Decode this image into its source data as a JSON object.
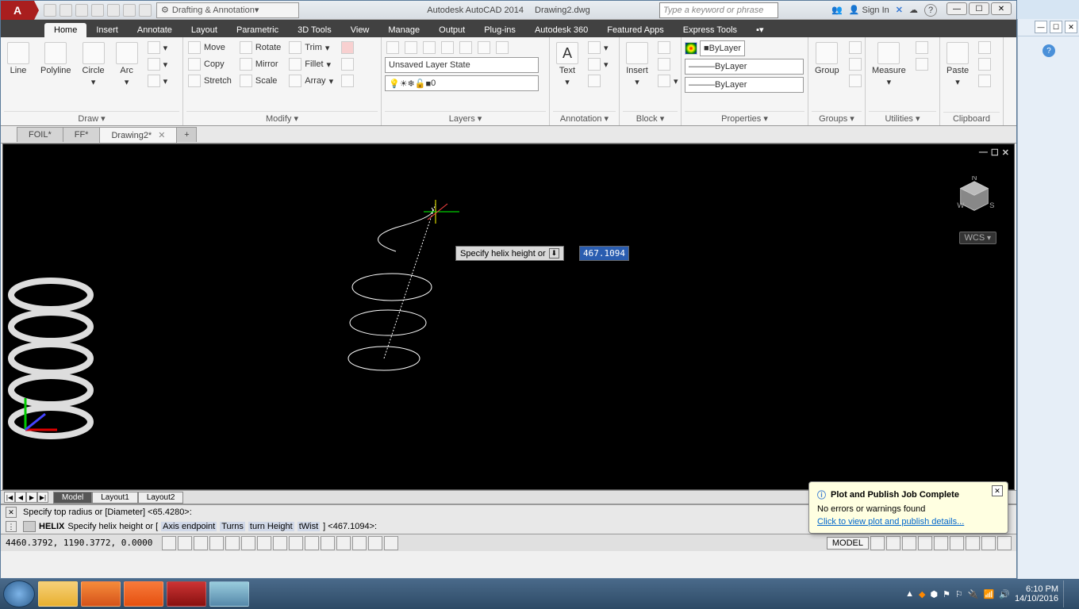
{
  "title": {
    "app": "Autodesk AutoCAD 2014",
    "file": "Drawing2.dwg"
  },
  "workspace": "Drafting & Annotation",
  "search_placeholder": "Type a keyword or phrase",
  "signin": "Sign In",
  "menu_tabs": [
    "Home",
    "Insert",
    "Annotate",
    "Layout",
    "Parametric",
    "3D Tools",
    "View",
    "Manage",
    "Output",
    "Plug-ins",
    "Autodesk 360",
    "Featured Apps",
    "Express Tools"
  ],
  "menu_active": "Home",
  "ribbon": {
    "draw": {
      "title": "Draw ▾",
      "line": "Line",
      "polyline": "Polyline",
      "circle": "Circle",
      "arc": "Arc"
    },
    "modify": {
      "title": "Modify ▾",
      "move": "Move",
      "rotate": "Rotate",
      "trim": "Trim",
      "copy": "Copy",
      "mirror": "Mirror",
      "fillet": "Fillet",
      "stretch": "Stretch",
      "scale": "Scale",
      "array": "Array"
    },
    "layers": {
      "title": "Layers ▾",
      "state": "Unsaved Layer State",
      "current": "0"
    },
    "annotation": {
      "title": "Annotation ▾",
      "text": "Text"
    },
    "block": {
      "title": "Block ▾",
      "insert": "Insert"
    },
    "properties": {
      "title": "Properties ▾",
      "bylayer": "ByLayer"
    },
    "groups": {
      "title": "Groups ▾",
      "group": "Group"
    },
    "utilities": {
      "title": "Utilities ▾",
      "measure": "Measure"
    },
    "clipboard": {
      "title": "Clipboard",
      "paste": "Paste"
    }
  },
  "file_tabs": [
    {
      "label": "FOIL*",
      "active": false
    },
    {
      "label": "FF*",
      "active": false
    },
    {
      "label": "Drawing2*",
      "active": true
    }
  ],
  "dynamic": {
    "prompt": "Specify helix height or",
    "value": "467.1094"
  },
  "wcs": "WCS",
  "model_tabs": [
    "Model",
    "Layout1",
    "Layout2"
  ],
  "cmd": {
    "prev": "Specify top radius or [Diameter] <65.4280>:",
    "cur_cmd": "HELIX",
    "cur_text": "Specify helix height or [",
    "opts": [
      "Axis endpoint",
      "Turns",
      "turn Height",
      "tWist"
    ],
    "cur_tail": "] <467.1094>:"
  },
  "coords": "4460.3792, 1190.3772, 0.0000",
  "status_model": "MODEL",
  "balloon": {
    "title": "Plot and Publish Job Complete",
    "msg": "No errors or warnings found",
    "link": "Click to view plot and publish details..."
  },
  "tray": {
    "time": "6:10 PM",
    "date": "14/10/2016"
  }
}
